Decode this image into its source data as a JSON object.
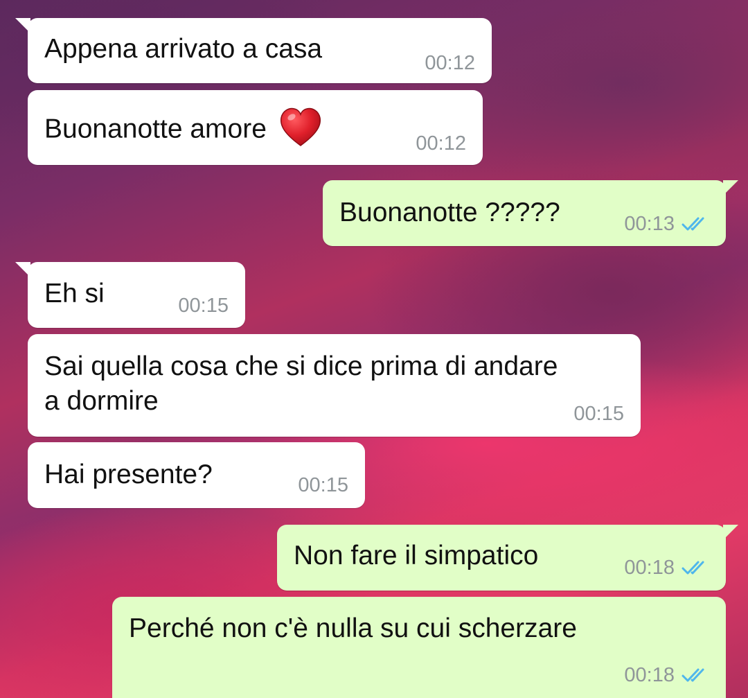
{
  "messages": [
    {
      "direction": "incoming",
      "text": "Appena arrivato a casa",
      "time": "00:12"
    },
    {
      "direction": "incoming",
      "text": "Buonanotte amore",
      "emoji": "red-heart",
      "time": "00:12"
    },
    {
      "direction": "outgoing",
      "text": "Buonanotte ?????",
      "time": "00:13",
      "status": "read-double-check"
    },
    {
      "direction": "incoming",
      "text": "Eh si",
      "time": "00:15"
    },
    {
      "direction": "incoming",
      "text_line1": "Sai quella cosa che si dice prima di andare",
      "text_line2": "a dormire",
      "time": "00:15"
    },
    {
      "direction": "incoming",
      "text": "Hai presente?",
      "time": "00:15"
    },
    {
      "direction": "outgoing",
      "text": "Non fare il simpatico",
      "time": "00:18",
      "status": "read-double-check"
    },
    {
      "direction": "outgoing",
      "text": "Perché non c'è nulla su cui scherzare",
      "time": "00:18",
      "status": "read-double-check"
    }
  ],
  "colors": {
    "incoming_bubble": "#ffffff",
    "outgoing_bubble": "#e1fec7",
    "timestamp": "#8f9599",
    "read_ticks": "#4fb6ec",
    "heart": "#e0202b"
  }
}
